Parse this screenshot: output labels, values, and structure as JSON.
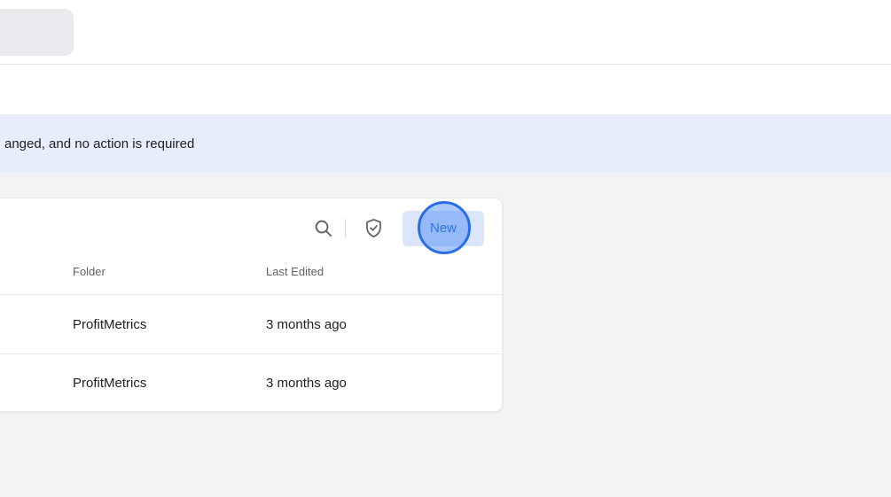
{
  "page": {
    "background_top": "#ffffff",
    "background_lower": "#f1f3f4"
  },
  "notification_banner": {
    "text": "anged, and no action is required",
    "background": "#e8edfb",
    "text_color": "#202124"
  },
  "card": {
    "toolbar": {
      "search_icon": "search-icon",
      "shield_icon": "shield-check-icon",
      "new_button": {
        "label": "New",
        "background": "#dbe6fa",
        "text_color": "#1a66d2"
      }
    },
    "table": {
      "columns": [
        {
          "label": "Folder"
        },
        {
          "label": "Last Edited"
        }
      ],
      "rows": [
        {
          "folder": "ProfitMetrics",
          "last_edited": "3 months ago"
        },
        {
          "folder": "ProfitMetrics",
          "last_edited": "3 months ago"
        }
      ]
    }
  },
  "click_indicator": {
    "ring_color": "#2b6de8",
    "fill_color": "rgba(66,133,244,0.45)"
  },
  "colors": {
    "icon": "#5f6368",
    "toolbar_divider": "#dadce0",
    "row_divider": "#e8eaed",
    "header_text": "#5f6368",
    "cell_text": "#202124",
    "tab_fill": "#e8eaed"
  }
}
